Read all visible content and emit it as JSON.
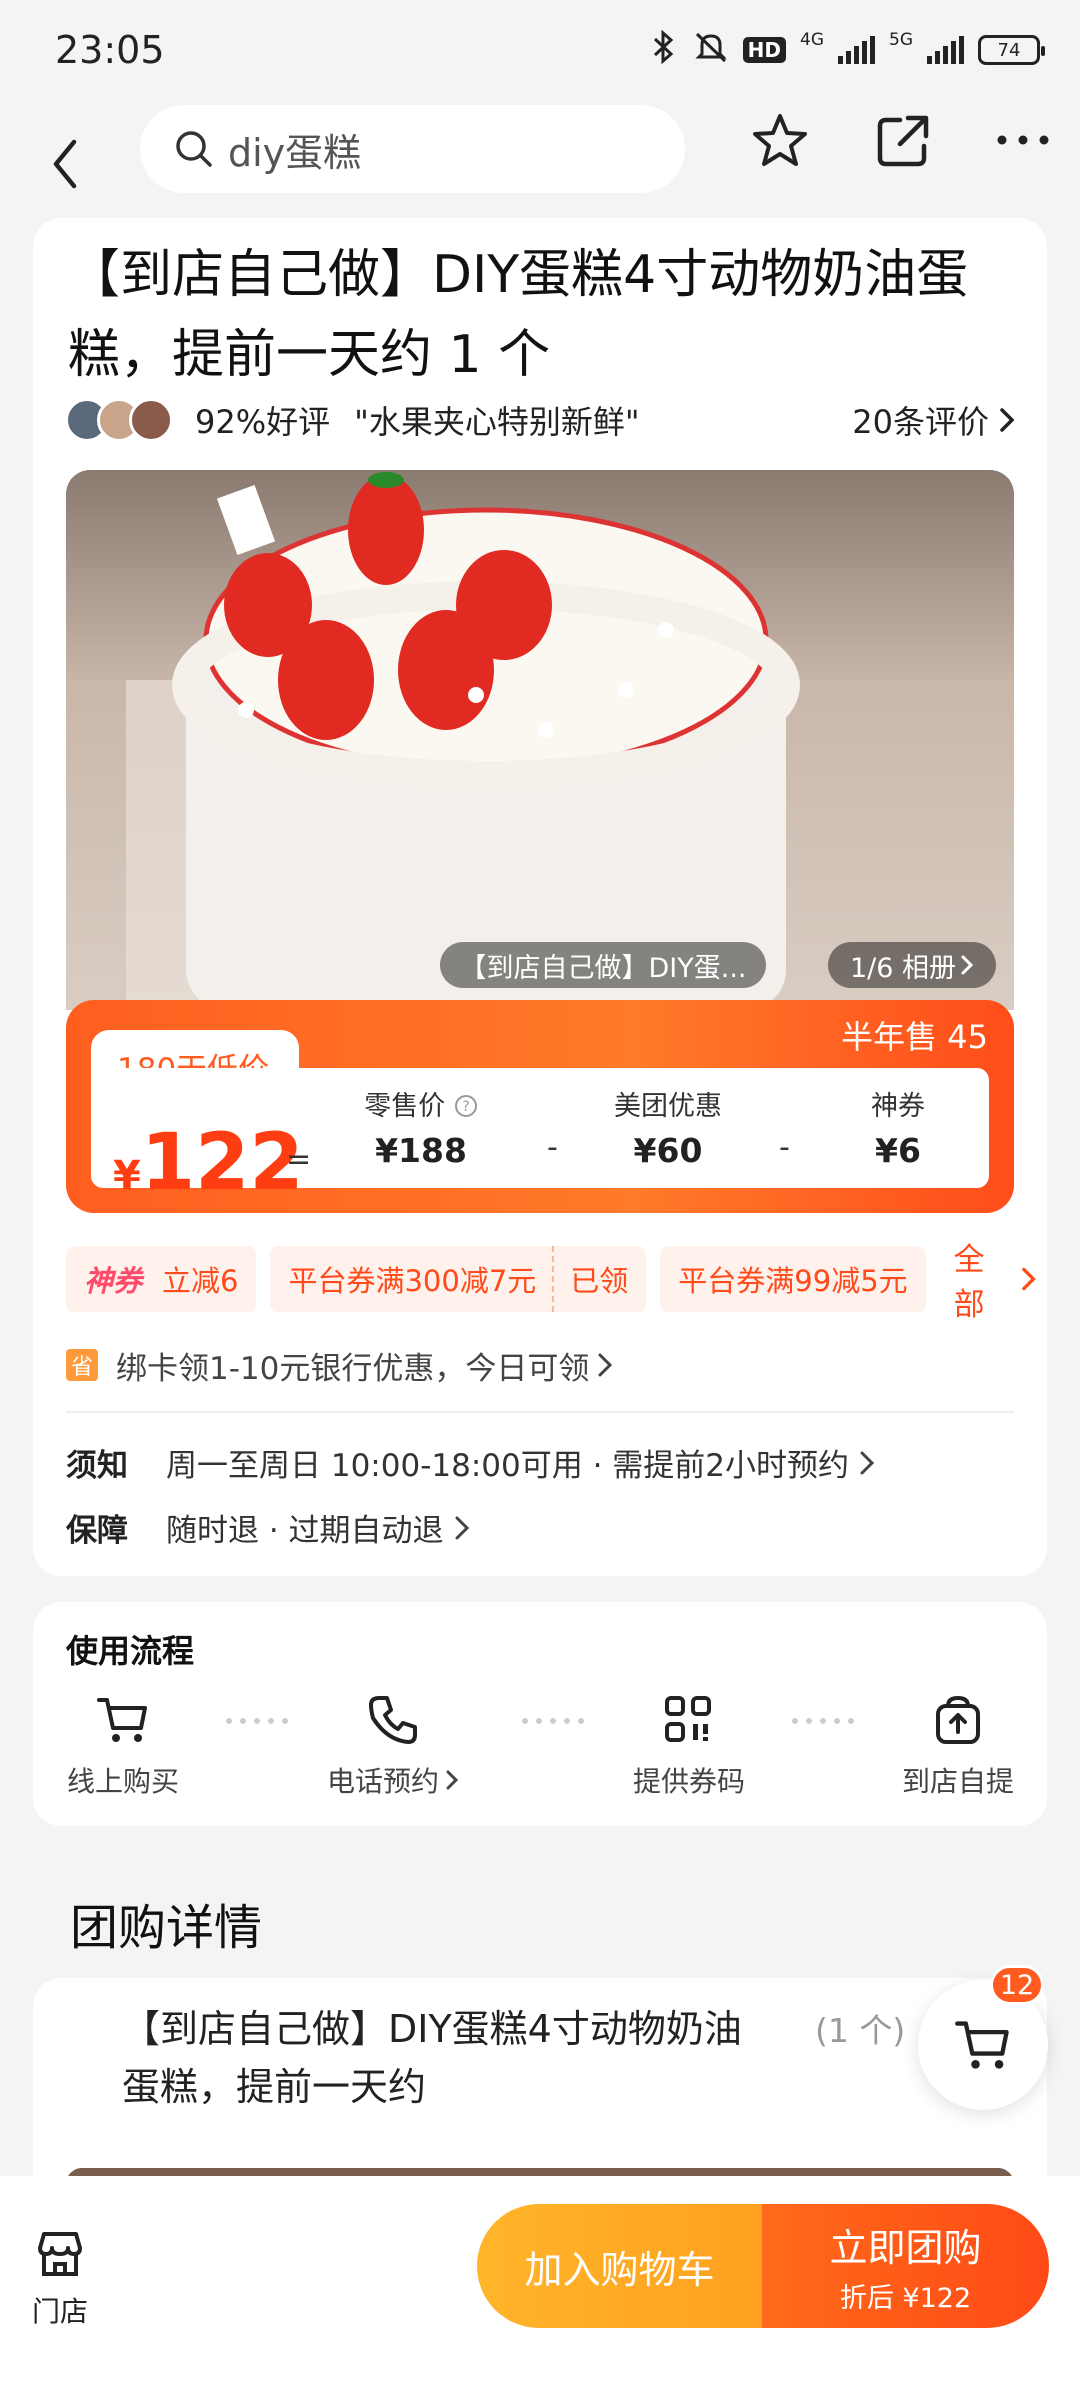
{
  "status_bar": {
    "time": "23:05",
    "net_a": "4G",
    "net_b": "5G",
    "hd": "HD",
    "battery": "74"
  },
  "search": {
    "placeholder": "diy蛋糕"
  },
  "product": {
    "title": "【到店自己做】DIY蛋糕4寸动物奶油蛋糕，提前一天约 1 个",
    "rating": "92%好评",
    "quote": "\"水果夹心特别新鲜\"",
    "review_count": "20条评价",
    "image_caption": "【到店自己做】DIY蛋...",
    "album": "1/6 相册"
  },
  "price": {
    "half_year_sales": "半年售 45",
    "low_label": "180天低价",
    "currency": "¥",
    "final": "122",
    "eq": "=",
    "retail_label": "零售价",
    "retail_value": "¥188",
    "meituan_label": "美团优惠",
    "meituan_value": "¥60",
    "coupon_label": "神券",
    "coupon_value": "¥6",
    "minus": "-"
  },
  "coupons": {
    "shen_tag": "神券",
    "shen_text": "立减6",
    "c1": "平台券满300减7元",
    "c1_status": "已领",
    "c2": "平台券满99减5元",
    "all": "全部"
  },
  "bank": {
    "icon_char": "省",
    "text": "绑卡领1-10元银行优惠，今日可领"
  },
  "notice": {
    "label": "须知",
    "value": "周一至周日 10:00-18:00可用 · 需提前2小时预约"
  },
  "guarantee": {
    "label": "保障",
    "value": "随时退 · 过期自动退"
  },
  "process": {
    "title": "使用流程",
    "steps": [
      "线上购买",
      "电话预约",
      "提供券码",
      "到店自提"
    ]
  },
  "group": {
    "title": "团购详情",
    "name": "【到店自己做】DIY蛋糕4寸动物奶油蛋糕，提前一天约",
    "qty": "(1 个)"
  },
  "cart": {
    "badge": "12"
  },
  "bottom": {
    "store": "门店",
    "add_cart": "加入购物车",
    "buy": "立即团购",
    "buy_sub": "折后 ¥122"
  }
}
